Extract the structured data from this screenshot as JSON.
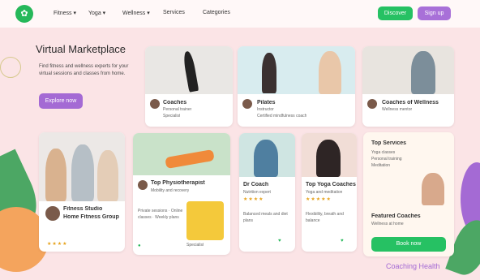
{
  "nav": {
    "logo": "✿",
    "items": [
      "Fitness ▾",
      "Yoga ▾",
      "Wellness ▾",
      "Services",
      "Categories"
    ],
    "btn_green": "Discover",
    "btn_purple": "Sign up"
  },
  "hero": {
    "title": "Virtual Marketplace",
    "body": "Find fitness and wellness experts for your virtual sessions and classes from home.",
    "cta": "Explore now"
  },
  "top_cards": [
    {
      "name": "Coaches",
      "line1": "Personal trainer",
      "line2": "Specialist"
    },
    {
      "name": "Pilates",
      "line1": "Instructor",
      "line2": "Certified mindfulness coach"
    },
    {
      "name": "",
      "line1": "",
      "line2": ""
    },
    {
      "name": "Coaches of Wellness",
      "line1": "Wellness mentor",
      "line2": ""
    }
  ],
  "left_card": {
    "name": "Fitness Studio",
    "sub": "Home Fitness Group",
    "stars": "★★★★"
  },
  "mid_card": {
    "name": "Top Physiotherapist",
    "line1": "Mobility and recovery",
    "sub_list": "Private sessions · Online classes · Weekly plans",
    "badge": "Specialist"
  },
  "small_card_1": {
    "name": "Dr Coach",
    "line1": "Nutrition expert",
    "stars": "★★★★",
    "foot": "Balanced meals and diet plans"
  },
  "small_card_2": {
    "name": "Top Yoga Coaches",
    "line1": "Yoga and meditation",
    "stars": "★★★★★",
    "foot": "Flexibility, breath and balance"
  },
  "right_card": {
    "title": "Top Services",
    "lines": [
      "Yoga classes",
      "Personal training",
      "Meditation"
    ],
    "foot_title": "Featured Coaches",
    "foot_sub": "Wellness at home",
    "btn": "Book now"
  },
  "footer": {
    "text": "Coaching Health"
  }
}
